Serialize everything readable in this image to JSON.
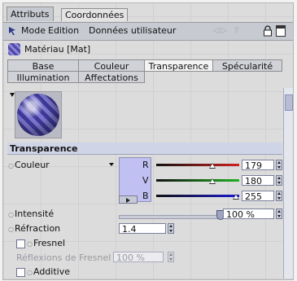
{
  "top_tabs": [
    {
      "label": "Attributs",
      "active": true
    },
    {
      "label": "Coordonnées",
      "active": false
    }
  ],
  "menu": {
    "items": [
      "Mode",
      "Edition",
      "Données utilisateur"
    ]
  },
  "material": {
    "title": "Matériau [Mat]"
  },
  "tabs": [
    {
      "label": "Base",
      "active": false
    },
    {
      "label": "Couleur",
      "active": false
    },
    {
      "label": "Transparence",
      "active": true
    },
    {
      "label": "Spécularité",
      "active": false
    },
    {
      "label": "Illumination",
      "active": false
    },
    {
      "label": "Affectations",
      "active": false
    }
  ],
  "section": {
    "title": "Transparence"
  },
  "color": {
    "label": "Couleur",
    "swatch_color": "#c0c0f2",
    "channels": [
      {
        "name": "R",
        "value": "179",
        "level": 0.702,
        "color": "#d02020"
      },
      {
        "name": "V",
        "value": "180",
        "level": 0.706,
        "color": "#20b020"
      },
      {
        "name": "B",
        "value": "255",
        "level": 1.0,
        "color": "#1a1ad0"
      }
    ]
  },
  "fields": {
    "intensity_label": "Intensité",
    "intensity_value": "100 %",
    "intensity_level": 1.0,
    "refraction_label": "Réfraction",
    "refraction_value": "1.4",
    "fresnel_label": "Fresnel",
    "fresnel_reflect_label": "Réflexions de Fresnel",
    "fresnel_reflect_value": "100 %",
    "additive_label": "Additive"
  }
}
